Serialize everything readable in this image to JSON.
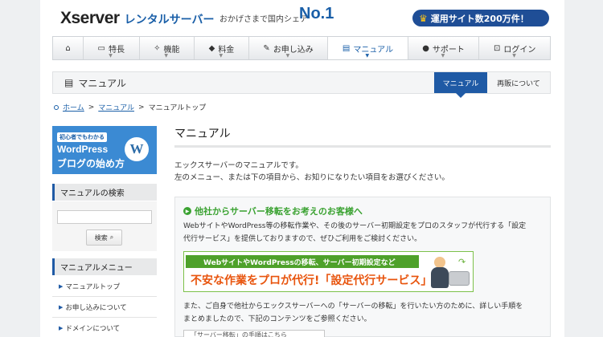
{
  "header": {
    "logo_main": "Xserver",
    "logo_sub": "レンタルサーバー",
    "tagline": "おかげさまで国内シェア",
    "tagline_badge": "No.1",
    "promo_badge": "運用サイト数200万件！"
  },
  "nav": {
    "items": [
      {
        "label": "",
        "icon": "home-icon"
      },
      {
        "label": "特長",
        "icon": "monitor-icon"
      },
      {
        "label": "機能",
        "icon": "magic-wand-icon"
      },
      {
        "label": "料金",
        "icon": "tag-icon"
      },
      {
        "label": "お申し込み",
        "icon": "pencil-icon"
      },
      {
        "label": "マニュアル",
        "icon": "book-icon",
        "active": true
      },
      {
        "label": "サポート",
        "icon": "person-icon"
      },
      {
        "label": "ログイン",
        "icon": "lock-icon"
      }
    ]
  },
  "titlebar": {
    "title": "マニュアル",
    "tab_active": "マニュアル",
    "tab_other": "再販について"
  },
  "breadcrumb": {
    "home": "ホーム",
    "manual": "マニュアル",
    "current": "マニュアルトップ",
    "sep": ">"
  },
  "sidebar": {
    "banner": {
      "small": "初心者でもわかる",
      "line1": "WordPress",
      "line2": "ブログの始め方",
      "logo": "W"
    },
    "search_title": "マニュアルの検索",
    "search_button": "検索",
    "menu_title": "マニュアルメニュー",
    "menu_items": [
      "マニュアルトップ",
      "お申し込みについて",
      "ドメインについて"
    ]
  },
  "main": {
    "title": "マニュアル",
    "intro_1": "エックスサーバーのマニュアルです。",
    "intro_2": "左のメニュー、または下の項目から、お知りになりたい項目をお選びください。",
    "panel": {
      "heading": "他社からサーバー移転をお考えのお客様へ",
      "text_1": "WebサイトやWordPress等の移転作業や、その後のサーバー初期設定をプロのスタッフが代行する「設定",
      "text_2": "代行サービス」を提供しておりますので、ぜひご利用をご検討ください。",
      "promo_top": "WebサイトやWordPressの移転、サーバー初期設定など",
      "promo_main": "不安な作業をプロが代行!「設定代行サービス」",
      "text_3": "また、ご自身で他社からエックスサーバーへの「サーバーの移転」を行いたい方のために、詳しい手順を",
      "text_4": "まとめましたので、下記のコンテンツをご参照ください。",
      "button": "「サーバー移転」の手順はこちら"
    }
  },
  "colors": {
    "accent_blue": "#1f5aa5",
    "green": "#3aa231",
    "orange": "#e8540d"
  }
}
